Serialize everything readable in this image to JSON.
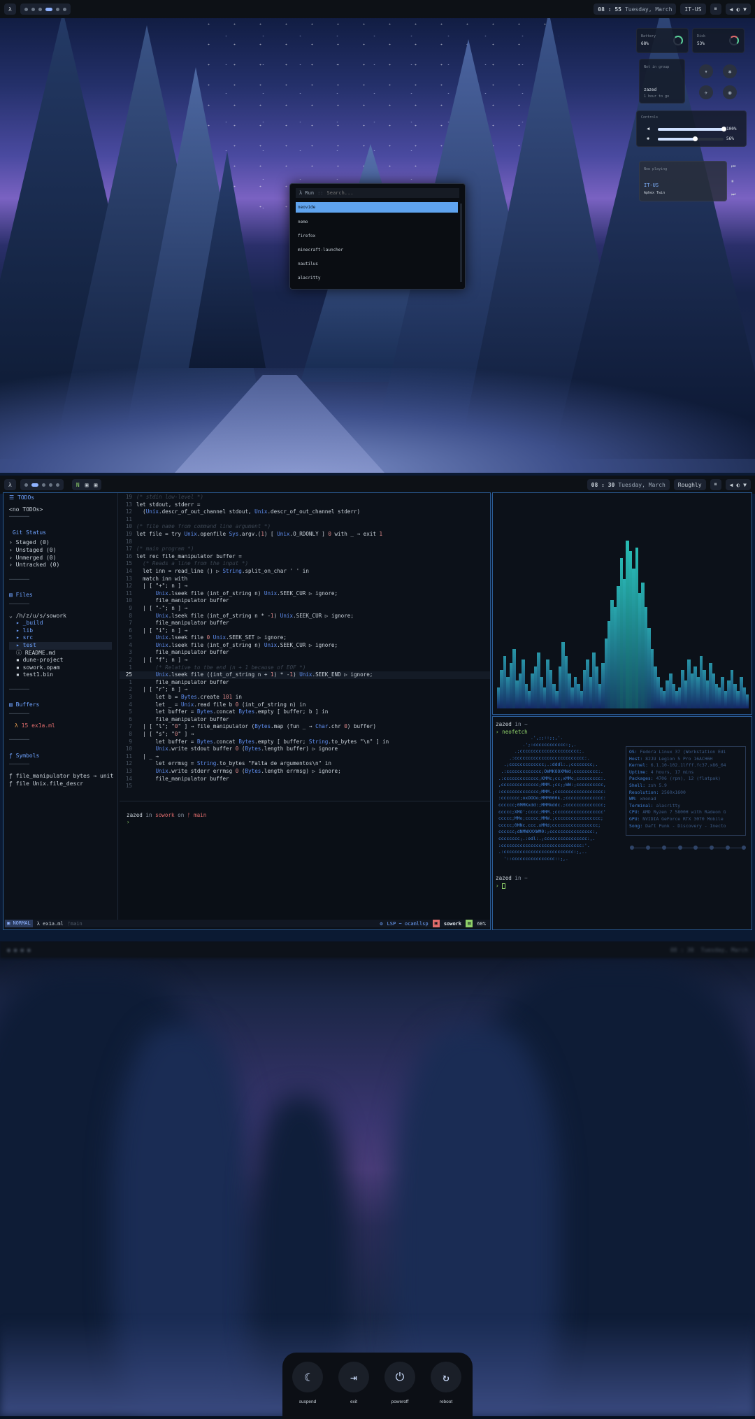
{
  "bar1": {
    "lambda": "λ",
    "clock": "08 : 55",
    "date": "Tuesday, March",
    "locale": "IT-US",
    "pause": "⏸"
  },
  "bar2": {
    "lambda": "λ",
    "clock": "08 : 30",
    "date": "Tuesday, March",
    "locale": "Roughly",
    "pause": "⏸"
  },
  "bar3": {
    "clock": "08 : 30",
    "date": "Tuesday, March"
  },
  "launcher": {
    "prompt": "λ Run",
    "placeholder": "Search...",
    "items": [
      "neovide",
      "nemo",
      "firefox",
      "minecraft-launcher",
      "nautilus",
      "alacritty"
    ]
  },
  "control_center": {
    "battery_label": "Battery",
    "battery_value": "68%",
    "disk_label": "Disk",
    "disk_value": "53%",
    "user_hint": "Not in group",
    "user_name": "zazed",
    "user_sub": "1 hour to go",
    "sliders_label": "Controls",
    "volume_value": "100%",
    "brightness_value": "56%",
    "media_label": "Now playing",
    "media_title": "IT-US",
    "media_artist": "Aphex Twin"
  },
  "nvim_tree": {
    "todos_header": "TODOs",
    "todos_empty": "<no TODOs>",
    "git_header": "Git Status",
    "git_items": [
      "Staged (0)",
      "Unstaged (0)",
      "Unmerged (0)",
      "Untracked (0)"
    ],
    "files_header": "Files",
    "root": "/h/z/u/s/sowork",
    "files": [
      " _build",
      " lib",
      " src",
      " test",
      " README.md",
      " dune-project",
      " sowork.opam",
      " test1.bin"
    ],
    "buffers_header": "Buffers",
    "buffer_item": "15 ex1a.ml",
    "symbols_header": "Symbols",
    "symbols": [
      "file_manipulator bytes → unit",
      "file Unix.file_descr"
    ]
  },
  "code": {
    "lines": [
      {
        "n": "19",
        "t": "(* stdin low-level *)",
        "c": "cm"
      },
      {
        "n": "13",
        "t": "let stdout, stderr =",
        "c": ""
      },
      {
        "n": "12",
        "t": "  (Unix.descr_of_out_channel stdout, Unix.descr_of_out_channel stderr)",
        "c": ""
      },
      {
        "n": "11",
        "t": "",
        "c": ""
      },
      {
        "n": "10",
        "t": "(* file name from command line argument *)",
        "c": "cm"
      },
      {
        "n": "19",
        "t": "let file = try Unix.openfile Sys.argv.(1) [ Unix.O_RDONLY ] 0 with _ → exit 1",
        "c": ""
      },
      {
        "n": "18",
        "t": "",
        "c": ""
      },
      {
        "n": "17",
        "t": "(* main program *)",
        "c": "cm"
      },
      {
        "n": "16",
        "t": "let rec file_manipulator buffer =",
        "c": ""
      },
      {
        "n": "15",
        "t": "  (* Reads a line from the input *)",
        "c": "cm"
      },
      {
        "n": "14",
        "t": "  let inn = read_line () ▷ String.split_on_char ' ' in",
        "c": ""
      },
      {
        "n": "13",
        "t": "  match inn with",
        "c": ""
      },
      {
        "n": "12",
        "t": "  | [ \"+\"; n ] →",
        "c": ""
      },
      {
        "n": "11",
        "t": "      Unix.lseek file (int_of_string n) Unix.SEEK_CUR ▷ ignore;",
        "c": ""
      },
      {
        "n": "10",
        "t": "      file_manipulator buffer",
        "c": ""
      },
      {
        "n": "9",
        "t": "  | [ \"-\"; n ] →",
        "c": ""
      },
      {
        "n": "8",
        "t": "      Unix.lseek file (int_of_string n * -1) Unix.SEEK_CUR ▷ ignore;",
        "c": ""
      },
      {
        "n": "7",
        "t": "      file_manipulator buffer",
        "c": ""
      },
      {
        "n": "6",
        "t": "  | [ \"i\"; n ] →",
        "c": ""
      },
      {
        "n": "5",
        "t": "      Unix.lseek file 0 Unix.SEEK_SET ▷ ignore;",
        "c": ""
      },
      {
        "n": "4",
        "t": "      Unix.lseek file (int_of_string n) Unix.SEEK_CUR ▷ ignore;",
        "c": ""
      },
      {
        "n": "3",
        "t": "      file_manipulator buffer",
        "c": ""
      },
      {
        "n": "2",
        "t": "  | [ \"f\"; n ] →",
        "c": ""
      },
      {
        "n": "1",
        "t": "      (* Relative to the end (n + 1 because of EOF *)",
        "c": "cm"
      },
      {
        "n": "25",
        "t": "      Unix.lseek file ((int_of_string n + 1) * -1) Unix.SEEK_END ▷ ignore;",
        "c": "cur"
      },
      {
        "n": "1",
        "t": "      file_manipulator buffer",
        "c": ""
      },
      {
        "n": "2",
        "t": "  | [ \"r\"; n ] →",
        "c": ""
      },
      {
        "n": "3",
        "t": "      let b = Bytes.create 101 in",
        "c": ""
      },
      {
        "n": "4",
        "t": "      let _ = Unix.read file b 0 (int_of_string n) in",
        "c": ""
      },
      {
        "n": "5",
        "t": "      let buffer = Bytes.concat Bytes.empty [ buffer; b ] in",
        "c": ""
      },
      {
        "n": "6",
        "t": "      file_manipulator buffer",
        "c": ""
      },
      {
        "n": "7",
        "t": "  | [ \"l\"; \"0\" ] → file_manipulator (Bytes.map (fun _ → Char.chr 0) buffer)",
        "c": ""
      },
      {
        "n": "8",
        "t": "  | [ \"s\"; \"0\" ] →",
        "c": ""
      },
      {
        "n": "9",
        "t": "      let buffer = Bytes.concat Bytes.empty [ buffer; String.to_bytes \"\\n\" ] in",
        "c": ""
      },
      {
        "n": "10",
        "t": "      Unix.write stdout buffer 0 (Bytes.length buffer) ▷ ignore",
        "c": ""
      },
      {
        "n": "11",
        "t": "  | _ →",
        "c": ""
      },
      {
        "n": "12",
        "t": "      let errmsg = String.to_bytes \"Falta de argumentos\\n\" in",
        "c": ""
      },
      {
        "n": "13",
        "t": "      Unix.write stderr errmsg 0 (Bytes.length errmsg) ▷ ignore;",
        "c": ""
      },
      {
        "n": "14",
        "t": "      file_manipulator buffer",
        "c": ""
      },
      {
        "n": "15",
        "t": "",
        "c": ""
      }
    ]
  },
  "terminal": {
    "prompt_user": "zazed",
    "prompt_in": " in ",
    "prompt_dir": "sowork",
    "prompt_on": " on ",
    "prompt_branch": " main",
    "prompt_arrow": "›"
  },
  "statusline": {
    "mode": "NORMAL",
    "file": "λ ex1a.ml",
    "branch": " main",
    "lsp": "LSP ~ ocamllsp",
    "project": "sowork",
    "percent": "60%"
  },
  "visualizer": {
    "heights": [
      0.12,
      0.22,
      0.3,
      0.18,
      0.26,
      0.34,
      0.16,
      0.2,
      0.28,
      0.14,
      0.1,
      0.2,
      0.24,
      0.32,
      0.18,
      0.12,
      0.28,
      0.22,
      0.14,
      0.1,
      0.24,
      0.38,
      0.3,
      0.2,
      0.12,
      0.18,
      0.14,
      0.1,
      0.22,
      0.28,
      0.18,
      0.32,
      0.24,
      0.14,
      0.26,
      0.4,
      0.5,
      0.62,
      0.58,
      0.7,
      0.86,
      0.74,
      0.96,
      0.9,
      0.8,
      0.92,
      0.66,
      0.72,
      0.58,
      0.46,
      0.34,
      0.24,
      0.18,
      0.12,
      0.1,
      0.16,
      0.2,
      0.14,
      0.1,
      0.12,
      0.22,
      0.16,
      0.28,
      0.2,
      0.24,
      0.18,
      0.3,
      0.22,
      0.16,
      0.26,
      0.2,
      0.14,
      0.12,
      0.18,
      0.1,
      0.16,
      0.22,
      0.14,
      0.1,
      0.18,
      0.12,
      0.08
    ]
  },
  "fetch": {
    "prompt1_user": "zazed",
    "prompt1_in": " in ~",
    "prompt1_cmd": "› neofetch",
    "logo": [
      "             .',;;::;;,'.",
      "          .';:cccccccccccc:;,.",
      "       .;cccccccccccccccccccccc;.",
      "     .:cccccccccccccccccccccccccc:.",
      "   .;ccccccccccccc;.:dddl:.;cccccccc;.",
      "  .:ccccccccccccc;OWMKOOXMWd;ccccccccc:.",
      " .:ccccccccccccc;KMMc;cc;xMMc;ccccccccc:.",
      " ,cccccccccccccc;MMM.;cc;;WW:;cccccccccc,",
      " :cccccccccccccc;MMM.;cccccccccccccccccc:",
      " :ccccccc;oxOOOo;MMM000k.;cccccccccccccc:",
      " cccccc;0MMKxdd:;MMMkddc.;cccccccccccccc;",
      " ccccc;XMO';cccc;MMM.;cccccccccccccccccc'",
      " ccccc;MMo;ccccc;MMW.;ccccccccccccccccc;",
      " ccccc;0MNc.ccc.xMMd;ccccccccccccccccc;",
      " cccccc;dNMWXXXWM0:;cccccccccccccccc:,",
      " cccccccc;.:odl:.;cccccccccccccccc:,.",
      " :cccccccccccccccccccccccccccccc:'.",
      " .:cccccccccccccccccccccccccc:;,..",
      "   '::cccccccccccccccc::;,."
    ],
    "info": [
      "OS: Fedora Linux 37 (Workstation Edi",
      "Host: 82JU Legion 5 Pro 16ACH6H",
      "Kernel: 6.1.10-102.1lfff.fc37.x86_64",
      "Uptime: 4 hours, 17 mins",
      "Packages: 4706 (rpm), 12 (flatpak)",
      "Shell: zsh 5.9",
      "Resolution: 2560x1600",
      "WM: xmonad",
      "Terminal: alacritty",
      "CPU: AMD Ryzen 7 5800H with Radeon G",
      "GPU: NVIDIA GeForce RTX 3070 Mobile",
      "Song: Daft Punk - Discovery - Inecto"
    ],
    "prompt2_user": "zazed",
    "prompt2_in": " in ~",
    "prompt2_cmd": "› "
  },
  "power": {
    "buttons": [
      {
        "label": "suspend",
        "icon": "☾"
      },
      {
        "label": "exit",
        "icon": "⇥"
      },
      {
        "label": "poweroff",
        "icon": "⏻"
      },
      {
        "label": "reboot",
        "icon": "↻"
      }
    ]
  }
}
